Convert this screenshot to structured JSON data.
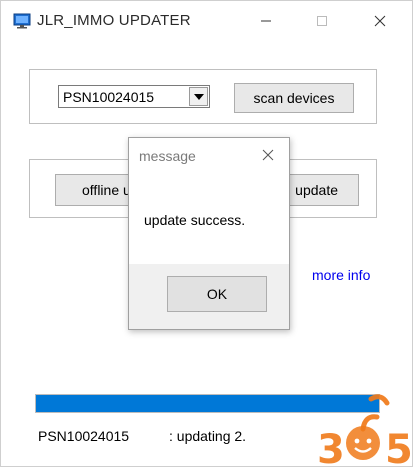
{
  "window": {
    "title": "JLR_IMMO UPDATER",
    "icon": "app-monitor-icon",
    "controls": {
      "minimize_icon": "minimize-icon",
      "maximize_icon": "maximize-icon",
      "close_icon": "close-icon"
    }
  },
  "device_select": {
    "value": "PSN10024015",
    "arrow_icon": "dropdown-arrow-icon"
  },
  "buttons": {
    "scan": "scan devices",
    "offline_update": "offline u",
    "update": "update"
  },
  "more_info": "more info",
  "progress": {
    "fraction": 1.0,
    "color": "#0078d7"
  },
  "status": {
    "device": "PSN10024015",
    "message": ": updating 2."
  },
  "dialog": {
    "title": "message",
    "message": "update success.",
    "ok": "OK"
  },
  "watermark": {
    "digits": [
      "3",
      "0",
      "5"
    ],
    "color_text": "#f07a1a",
    "color_zero": "#2a9fd6"
  },
  "colors": {
    "link": "#0000ee",
    "accent": "#0078d7"
  }
}
